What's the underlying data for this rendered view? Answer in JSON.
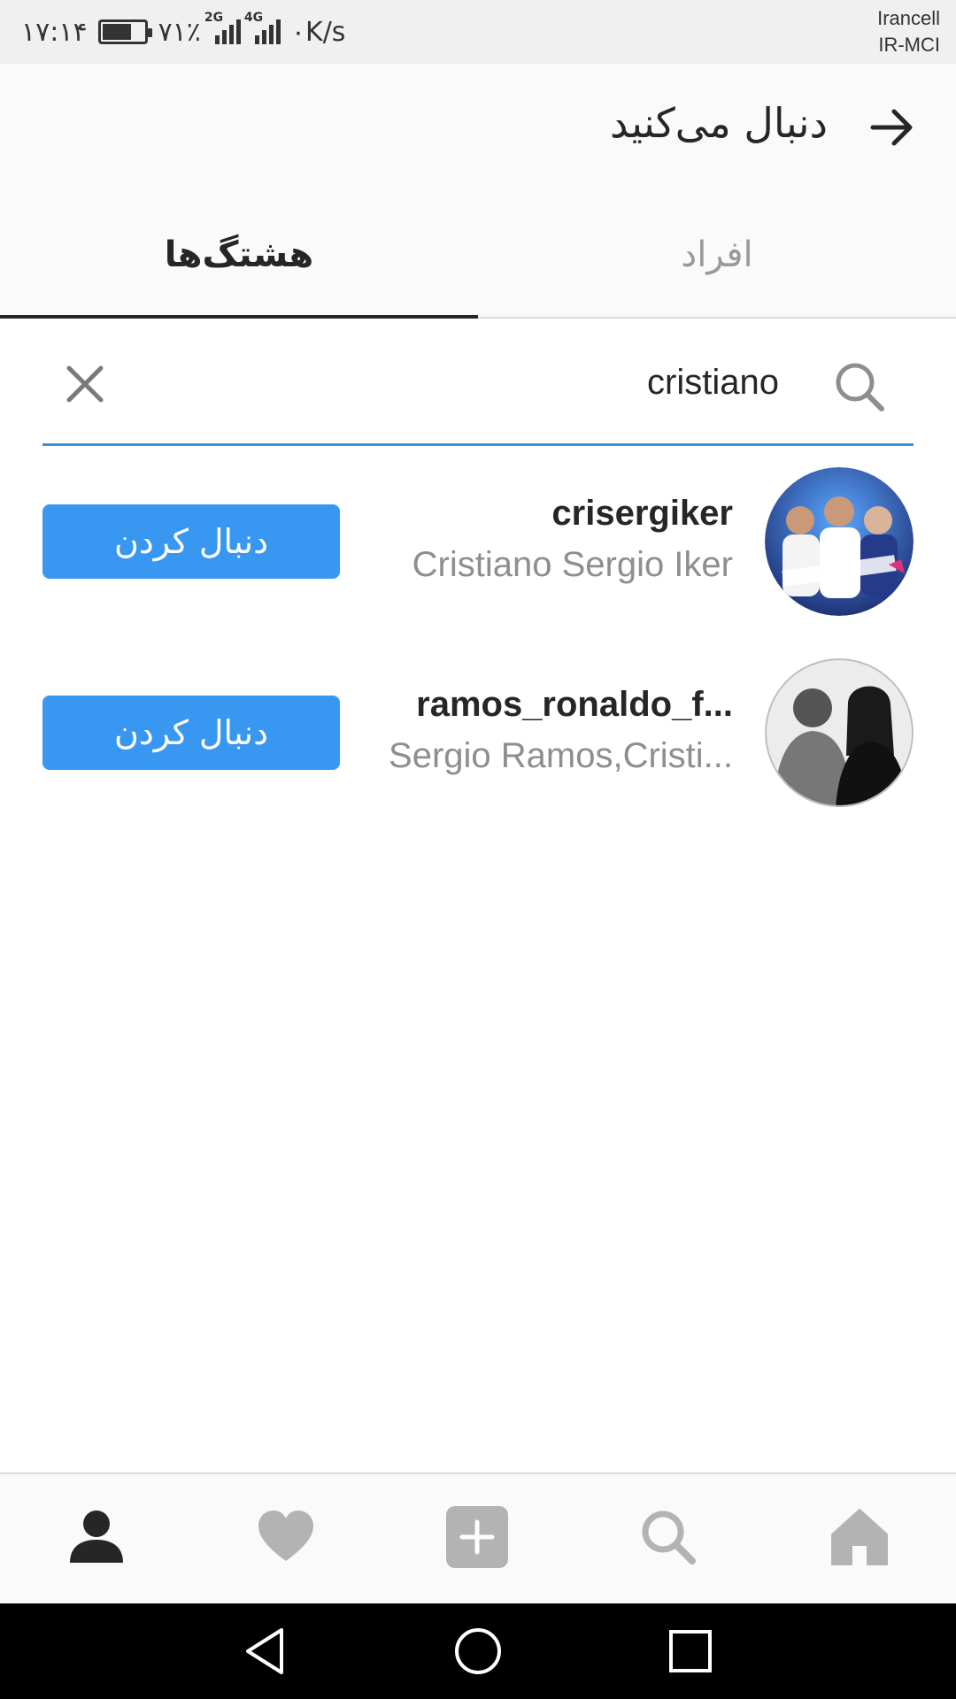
{
  "status_bar": {
    "time": "۱۷:۱۴",
    "battery": "۷۱٪",
    "battery_level": 0.71,
    "net_2g": "2G",
    "net_4g": "4G",
    "speed": "۰K/s",
    "carrier_1": "Irancell",
    "carrier_2": "IR-MCI"
  },
  "header": {
    "title": "دنبال می‌کنید",
    "back_icon": "arrow-right-icon"
  },
  "tabs": [
    {
      "label": "هشتگ‌ها",
      "active": true
    },
    {
      "label": "افراد",
      "active": false
    }
  ],
  "search": {
    "value": "cristiano",
    "search_icon": "search-icon",
    "clear_icon": "close-icon"
  },
  "results": [
    {
      "username": "crisergiker",
      "full_name": "Cristiano Sergio Iker",
      "button_label": "دنبال کردن"
    },
    {
      "username": "ramos_ronaldo_f...",
      "full_name": "Sergio Ramos,Cristi...",
      "button_label": "دنبال کردن"
    }
  ],
  "bottom_nav": [
    "profile-icon",
    "heart-icon",
    "add-icon",
    "search-icon",
    "home-icon"
  ],
  "colors": {
    "accent": "#3897f0",
    "search_underline": "#3b8fd9",
    "text_primary": "#262626",
    "text_secondary": "#8e8e8e"
  }
}
